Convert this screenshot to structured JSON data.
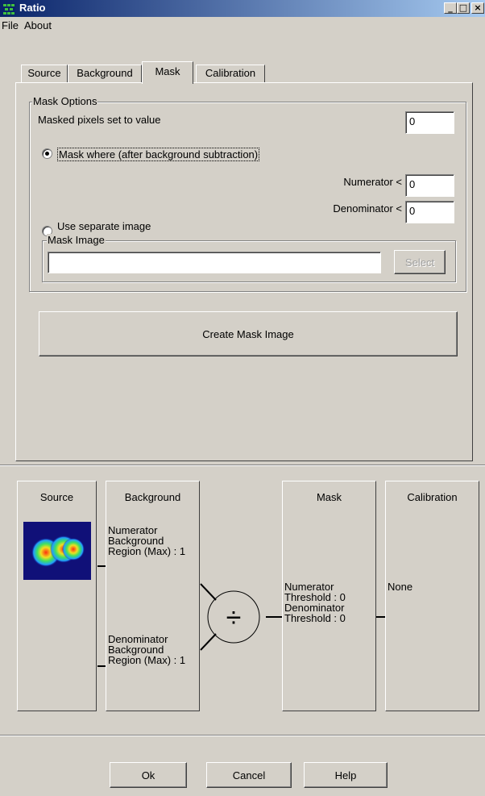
{
  "window": {
    "title": "Ratio",
    "controls": [
      "_",
      "□",
      "×"
    ]
  },
  "menu": [
    "File",
    "About"
  ],
  "tabs": [
    {
      "label": "Source",
      "active": false
    },
    {
      "label": "Background",
      "active": false
    },
    {
      "label": "Mask",
      "active": true
    },
    {
      "label": "Calibration",
      "active": false
    }
  ],
  "mask_options": {
    "group_label": "Mask Options",
    "masked_pixels_label": "Masked pixels set to value",
    "masked_pixels_value": "0",
    "radio_mask_where": {
      "label": "Mask where (after background subtraction)",
      "checked": true
    },
    "numerator_label": "Numerator <",
    "numerator_value": "0",
    "denominator_label": "Denominator <",
    "denominator_value": "0",
    "radio_separate": {
      "label": "Use separate image",
      "checked": false
    },
    "mask_image_group": "Mask Image",
    "mask_image_value": "",
    "select_button": "Select"
  },
  "create_mask_button": "Create Mask Image",
  "workflow": {
    "source": {
      "title": "Source"
    },
    "background": {
      "title": "Background",
      "numerator_text": [
        "Numerator",
        "Background",
        "Region (Max) : 1"
      ],
      "denominator_text": [
        "Denominator",
        "Background",
        "Region (Max) : 1"
      ]
    },
    "divide_symbol": "÷",
    "mask": {
      "title": "Mask",
      "text": [
        "Numerator",
        "Threshold : 0",
        "Denominator",
        "Threshold : 0"
      ]
    },
    "calibration": {
      "title": "Calibration",
      "text": "None"
    }
  },
  "buttons": {
    "ok": "Ok",
    "cancel": "Cancel",
    "help": "Help"
  },
  "colors": {
    "titlebar_start": "#0a246a",
    "titlebar_end": "#a6caf0",
    "face": "#d4d0c8"
  }
}
